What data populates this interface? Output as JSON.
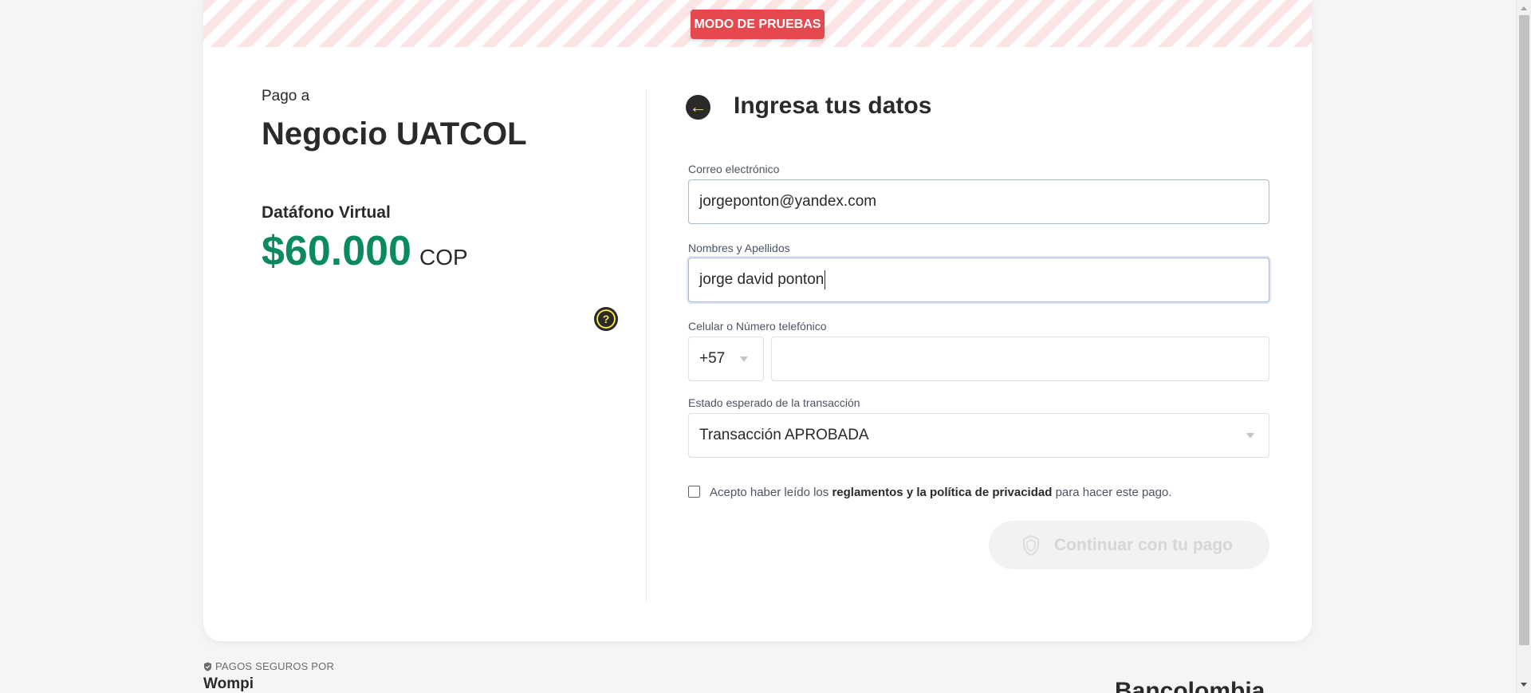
{
  "banner": {
    "test_mode": "MODO DE PRUEBAS"
  },
  "summary": {
    "pay_to_label": "Pago a",
    "merchant_name": "Negocio UATCOL",
    "product_name": "Datáfono Virtual",
    "amount": "$60.000",
    "currency": "COP",
    "help_icon_glyph": "?"
  },
  "form": {
    "title": "Ingresa tus datos",
    "back_icon_glyph": "←",
    "email": {
      "label": "Correo electrónico",
      "value": "jorgeponton@yandex.com"
    },
    "name": {
      "label": "Nombres y Apellidos",
      "value": "jorge david ponton"
    },
    "phone": {
      "label": "Celular o Número telefónico",
      "country_code": "+57",
      "value": ""
    },
    "status": {
      "label": "Estado esperado de la transacción",
      "selected": "Transacción APROBADA"
    },
    "terms": {
      "prefix": "Acepto haber leído los",
      "link": "reglamentos y la política de privacidad",
      "suffix": "para hacer este pago.",
      "checked": false
    },
    "continue_label": "Continuar con tu pago"
  },
  "footer": {
    "secure_label": "PAGOS SEGUROS POR",
    "wompi": "Wompi",
    "bancolombia": "Bancolombia"
  },
  "colors": {
    "accent_green": "#0b8a5e",
    "test_badge_red": "#e5484d",
    "brand_yellow": "#f5e742"
  },
  "icons": [
    "back-arrow-icon",
    "help-icon",
    "chevron-down-icon",
    "shield-icon"
  ]
}
